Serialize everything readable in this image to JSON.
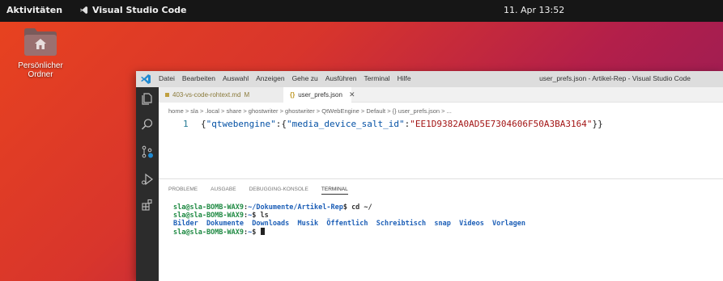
{
  "topbar": {
    "activities": "Aktivitäten",
    "app_name": "Visual Studio Code",
    "clock": "11. Apr 13:52"
  },
  "desktop": {
    "home_folder_label": "Persönlicher Ordner"
  },
  "window": {
    "menu": [
      "Datei",
      "Bearbeiten",
      "Auswahl",
      "Anzeigen",
      "Gehe zu",
      "Ausführen",
      "Terminal",
      "Hilfe"
    ],
    "title": "user_prefs.json - Artikel-Rep - Visual Studio Code"
  },
  "tabs": [
    {
      "label": "403-vs-code-rohtext.md",
      "badge": "M"
    },
    {
      "label": "user_prefs.json",
      "icon": "{}"
    }
  ],
  "breadcrumb": "home > sla > .local > share > ghostwriter > ghostwriter > QtWebEngine > Default > {} user_prefs.json > ...",
  "editor": {
    "line_number": "1",
    "open_brace": "{",
    "key1": "\"qtwebengine\"",
    "colon1": ":{",
    "key2": "\"media_device_salt_id\"",
    "colon2": ":",
    "value": "\"EE1D9382A0AD5E7304606F50A3BA3164\"",
    "close": "}}"
  },
  "panel": {
    "tabs": [
      "PROBLEME",
      "AUSGABE",
      "DEBUGGING-KONSOLE",
      "TERMINAL"
    ]
  },
  "terminal": {
    "user_host": "sla@sla-BOMB-WAX9",
    "line1_path": "~/Dokumente/Artikel-Rep",
    "line1_cmd": "$ cd ~/",
    "line2_path": "~",
    "line2_cmd": "$ ls",
    "ls_output": "Bilder  Dokumente  Downloads  Musik  Öffentlich  Schreibtisch  snap  Videos  Vorlagen",
    "line3_path": "~",
    "line3_prompt": "$ "
  },
  "colors": {
    "activity_bar": "#2c2c2c",
    "top_bar": "#161616",
    "terminal_user": "#1f8a43",
    "terminal_path": "#1d5fb7"
  }
}
